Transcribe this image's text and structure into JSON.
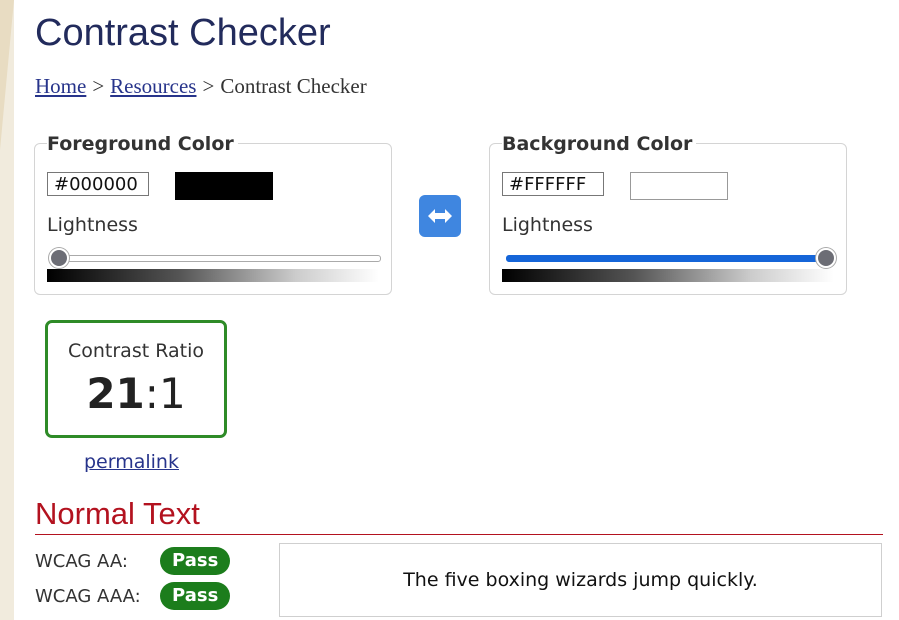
{
  "page": {
    "title": "Contrast Checker"
  },
  "breadcrumb": {
    "home": "Home",
    "separator": ">",
    "resources": "Resources",
    "current": "Contrast Checker"
  },
  "foreground": {
    "legend": "Foreground Color",
    "hex": "#000000",
    "lightness_label": "Lightness",
    "lightness_fraction": 0.0,
    "swatch_color": "#000000"
  },
  "background": {
    "legend": "Background Color",
    "hex": "#FFFFFF",
    "lightness_label": "Lightness",
    "lightness_fraction": 1.0,
    "swatch_color": "#FFFFFF"
  },
  "swap": {
    "icon": "swap-arrows-icon",
    "color": "#3f86e0"
  },
  "contrast": {
    "label": "Contrast Ratio",
    "ratio_num": "21",
    "ratio_sep": ":",
    "ratio_den": "1",
    "border_color": "#2e8b27"
  },
  "permalink": "permalink",
  "normal_text": {
    "heading": "Normal Text",
    "aa_label": "WCAG AA:",
    "aa_result": "Pass",
    "aaa_label": "WCAG AAA:",
    "aaa_result": "Pass",
    "sample": "The five boxing wizards jump quickly."
  },
  "colors": {
    "title": "#222b5c",
    "heading": "#b3121f",
    "pass": "#1c7d1c",
    "link": "#27348b",
    "slider_fill": "#1565d8"
  }
}
